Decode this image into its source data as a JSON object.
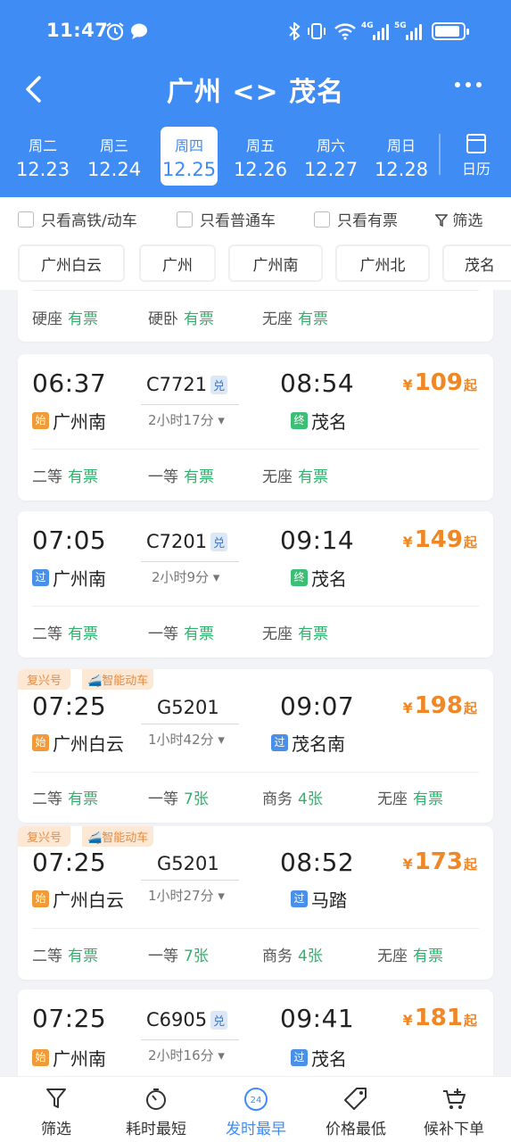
{
  "status_bar": {
    "time": "11:47",
    "network": "4G",
    "network2": "5G"
  },
  "header": {
    "title": "广州 <> 茂名"
  },
  "dates": [
    {
      "weekday": "周二",
      "date": "12.23"
    },
    {
      "weekday": "周三",
      "date": "12.24"
    },
    {
      "weekday": "周四",
      "date": "12.25",
      "active": true
    },
    {
      "weekday": "周五",
      "date": "12.26"
    },
    {
      "weekday": "周六",
      "date": "12.27"
    },
    {
      "weekday": "周日",
      "date": "12.28"
    }
  ],
  "calendar_label": "日历",
  "filters": {
    "high_speed": "只看高铁/动车",
    "normal": "只看普通车",
    "available": "只看有票",
    "filter": "筛选"
  },
  "stations": [
    "广州白云",
    "广州",
    "广州南",
    "广州北",
    "茂名"
  ],
  "partial_card": {
    "seats": [
      {
        "name": "硬座",
        "status": "有票"
      },
      {
        "name": "硬卧",
        "status": "有票"
      },
      {
        "name": "无座",
        "status": "有票"
      }
    ]
  },
  "trains": [
    {
      "dep_time": "06:37",
      "train_no": "C7721",
      "dui": "兑",
      "arr_time": "08:54",
      "duration": "2小时17分",
      "dep_tag": "始",
      "dep_station": "广州南",
      "arr_tag": "终",
      "arr_station": "茂名",
      "price_symbol": "¥",
      "price": "109",
      "price_suffix": "起",
      "seats": [
        {
          "name": "二等",
          "status": "有票"
        },
        {
          "name": "一等",
          "status": "有票"
        },
        {
          "name": "无座",
          "status": "有票"
        }
      ]
    },
    {
      "dep_time": "07:05",
      "train_no": "C7201",
      "dui": "兑",
      "arr_time": "09:14",
      "duration": "2小时9分",
      "dep_tag": "过",
      "dep_station": "广州南",
      "arr_tag": "终",
      "arr_station": "茂名",
      "price_symbol": "¥",
      "price": "149",
      "price_suffix": "起",
      "seats": [
        {
          "name": "二等",
          "status": "有票"
        },
        {
          "name": "一等",
          "status": "有票"
        },
        {
          "name": "无座",
          "status": "有票"
        }
      ]
    },
    {
      "badge1": "复兴号",
      "badge2": "智能动车",
      "dep_time": "07:25",
      "train_no": "G5201",
      "arr_time": "09:07",
      "duration": "1小时42分",
      "dep_tag": "始",
      "dep_station": "广州白云",
      "arr_tag": "过",
      "arr_station": "茂名南",
      "price_symbol": "¥",
      "price": "198",
      "price_suffix": "起",
      "seats": [
        {
          "name": "二等",
          "status": "有票"
        },
        {
          "name": "一等",
          "status": "7张"
        },
        {
          "name": "商务",
          "status": "4张"
        },
        {
          "name": "无座",
          "status": "有票"
        }
      ]
    },
    {
      "badge1": "复兴号",
      "badge2": "智能动车",
      "dep_time": "07:25",
      "train_no": "G5201",
      "arr_time": "08:52",
      "duration": "1小时27分",
      "dep_tag": "始",
      "dep_station": "广州白云",
      "arr_tag": "过",
      "arr_station": "马踏",
      "price_symbol": "¥",
      "price": "173",
      "price_suffix": "起",
      "seats": [
        {
          "name": "二等",
          "status": "有票"
        },
        {
          "name": "一等",
          "status": "7张"
        },
        {
          "name": "商务",
          "status": "4张"
        },
        {
          "name": "无座",
          "status": "有票"
        }
      ]
    },
    {
      "dep_time": "07:25",
      "train_no": "C6905",
      "dui": "兑",
      "arr_time": "09:41",
      "duration": "2小时16分",
      "dep_tag": "始",
      "dep_station": "广州南",
      "arr_tag": "过",
      "arr_station": "茂名",
      "price_symbol": "¥",
      "price": "181",
      "price_suffix": "起"
    }
  ],
  "bottom_nav": [
    {
      "label": "筛选",
      "icon": "filter-icon"
    },
    {
      "label": "耗时最短",
      "icon": "timer-icon"
    },
    {
      "label": "发时最早",
      "icon": "clock-24-icon",
      "badge": "24",
      "active": true
    },
    {
      "label": "价格最低",
      "icon": "price-tag-icon"
    },
    {
      "label": "候补下单",
      "icon": "cart-plus-icon"
    }
  ],
  "colors": {
    "primary": "#3e8cf4",
    "price": "#f08726",
    "available": "#2eb36b"
  }
}
